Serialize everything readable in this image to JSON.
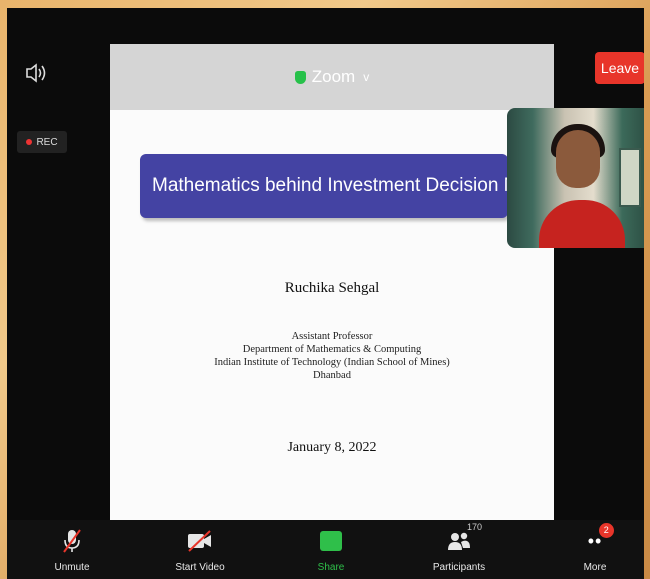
{
  "header": {
    "app_name": "Zoom",
    "chevron": "v",
    "leave_label": "Leave",
    "rec_label": "REC"
  },
  "icons": {
    "speaker": "speaker-icon",
    "shield": "shield-icon"
  },
  "slide": {
    "title": "Mathematics behind Investment Decision Making",
    "author": "Ruchika Sehgal",
    "affiliation": [
      "Assistant Professor",
      "Department of Mathematics & Computing",
      "Indian Institute of Technology (Indian School of Mines)",
      "Dhanbad"
    ],
    "date": "January 8, 2022"
  },
  "toolbar": {
    "unmute_label": "Unmute",
    "start_video_label": "Start Video",
    "share_label": "Share",
    "participants_label": "Participants",
    "participants_count": "170",
    "more_label": "More",
    "more_badge": "2"
  },
  "colors": {
    "leave": "#e8352a",
    "title_bar": "#4443a3",
    "share_green": "#2fbf4a"
  }
}
